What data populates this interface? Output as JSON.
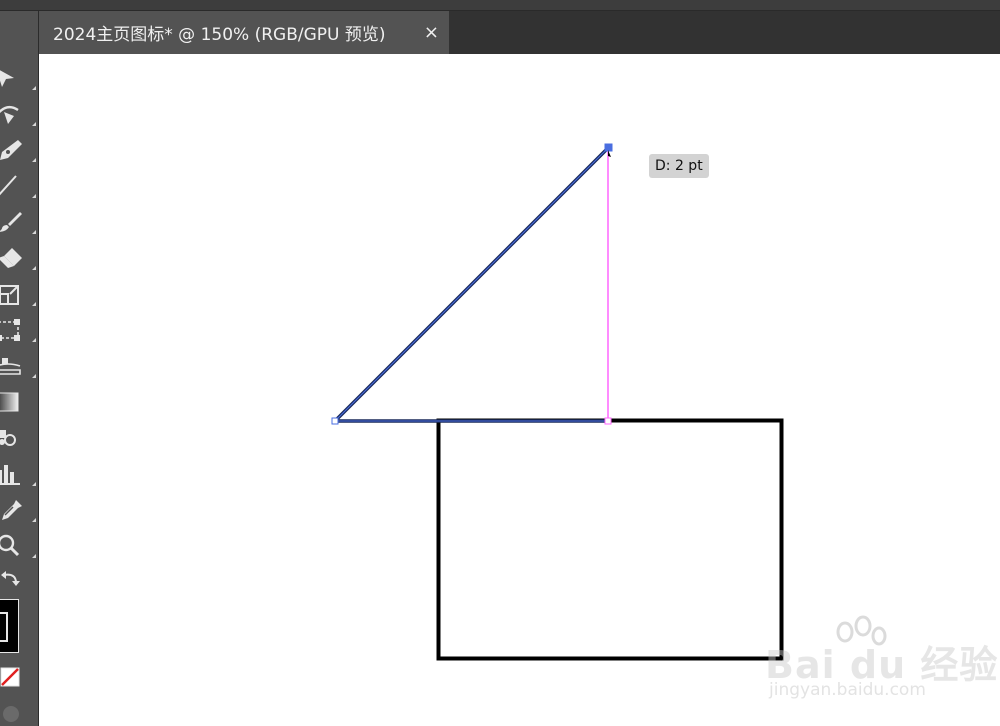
{
  "document_tab": {
    "title": "2024主页图标* @ 150% (RGB/GPU 预览)",
    "close_label": "×"
  },
  "toolbar": {
    "tools": [
      {
        "name": "selection-tool",
        "icon": "arrow-icon"
      },
      {
        "name": "curvature-tool",
        "icon": "curvature-icon"
      },
      {
        "name": "pen-tool",
        "icon": "pen-icon"
      },
      {
        "name": "line-tool",
        "icon": "line-icon"
      },
      {
        "name": "paintbrush-tool",
        "icon": "brush-icon"
      },
      {
        "name": "eraser-tool",
        "icon": "eraser-icon"
      },
      {
        "name": "scale-tool",
        "icon": "scale-icon"
      },
      {
        "name": "free-transform-tool",
        "icon": "transform-icon"
      },
      {
        "name": "shape-builder-tool",
        "icon": "shape-builder-icon"
      },
      {
        "name": "gradient-tool",
        "icon": "gradient-icon"
      },
      {
        "name": "symbol-sprayer-tool",
        "icon": "symbol-sprayer-icon"
      },
      {
        "name": "graph-tool",
        "icon": "bar-graph-icon"
      },
      {
        "name": "eyedropper-tool",
        "icon": "eyedropper-icon"
      },
      {
        "name": "zoom-tool",
        "icon": "magnifier-icon"
      },
      {
        "name": "swap-fill-stroke",
        "icon": "swap-arrow-icon"
      }
    ],
    "fill_color": "#000000",
    "stroke_none": true
  },
  "canvas": {
    "measure_tooltip": "D: 2 pt",
    "colors": {
      "path": "#1a2a5a",
      "selection": "#4a6ee0",
      "smart_guide": "#ff66ff",
      "rectangle_stroke": "#000000"
    }
  },
  "watermark": {
    "logo_text": "Bai du 经验",
    "url": "jingyan.baidu.com"
  }
}
